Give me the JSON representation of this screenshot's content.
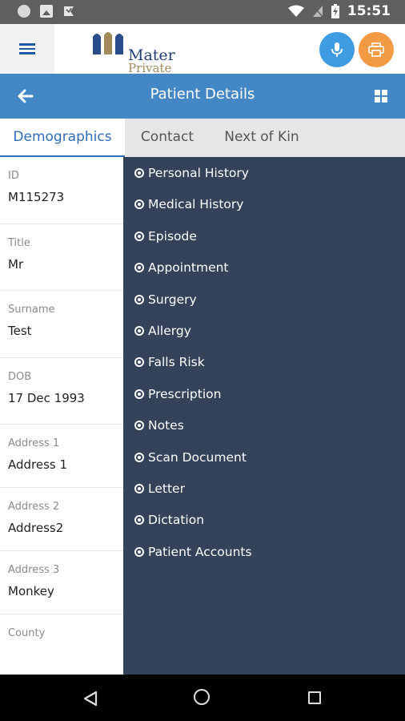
{
  "status_bar": {
    "time": "15:51"
  },
  "app": {
    "logo": {
      "line1": "Mater",
      "line2": "Private"
    },
    "title": "Patient Details"
  },
  "tabs": [
    {
      "label": "Demographics",
      "active": true
    },
    {
      "label": "Contact",
      "active": false
    },
    {
      "label": "Next of Kin",
      "active": false
    }
  ],
  "fields": [
    {
      "label": "ID",
      "value": "M115273"
    },
    {
      "label": "Title",
      "value": "Mr"
    },
    {
      "label": "Surname",
      "value": "Test"
    },
    {
      "label": "DOB",
      "value": "17 Dec 1993"
    },
    {
      "label": "Address 1",
      "value": "Address 1"
    },
    {
      "label": "Address 2",
      "value": "Address2"
    },
    {
      "label": "Address 3",
      "value": "Monkey"
    },
    {
      "label": "County",
      "value": ""
    }
  ],
  "menu": [
    {
      "label": "Personal History"
    },
    {
      "label": "Medical History"
    },
    {
      "label": "Episode"
    },
    {
      "label": "Appointment"
    },
    {
      "label": "Surgery"
    },
    {
      "label": "Allergy"
    },
    {
      "label": "Falls Risk"
    },
    {
      "label": "Prescription"
    },
    {
      "label": "Notes"
    },
    {
      "label": "Scan Document"
    },
    {
      "label": "Letter"
    },
    {
      "label": "Dictation"
    },
    {
      "label": "Patient Accounts"
    }
  ],
  "colors": {
    "title_bar": "#4487c5",
    "menu_panel": "#34435a",
    "mic_button": "#3f9ce3",
    "print_button": "#f39a45",
    "active_tab": "#2f6cb7"
  },
  "icons": {
    "menu": "hamburger-icon",
    "mic": "microphone-icon",
    "print": "printer-icon",
    "back": "arrow-left-icon",
    "grid": "grid-icon",
    "menu_bullet": "radio-bullet-icon"
  }
}
